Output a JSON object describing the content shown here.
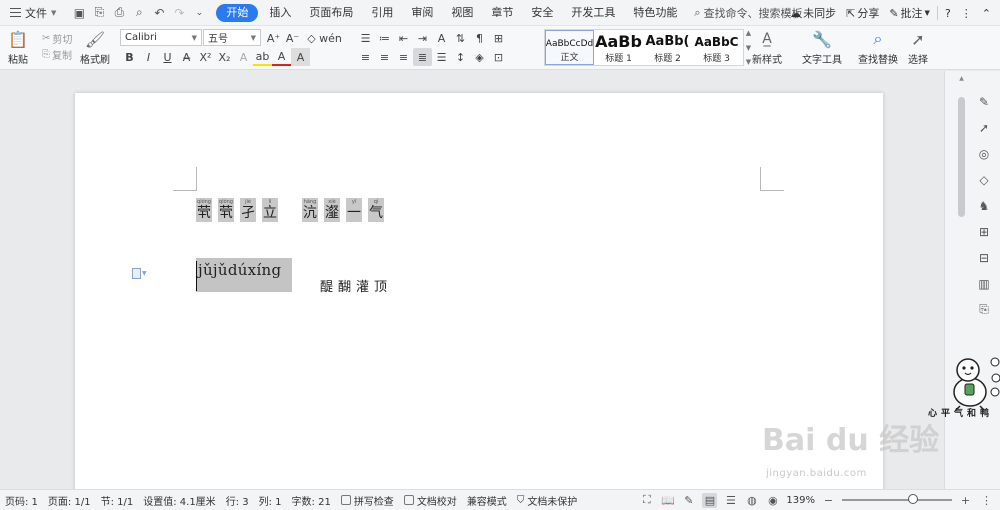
{
  "menubar": {
    "file_label": "文件",
    "tabs": [
      "开始",
      "插入",
      "页面布局",
      "引用",
      "审阅",
      "视图",
      "章节",
      "安全",
      "开发工具",
      "特色功能"
    ],
    "active_tab": "开始",
    "search_label": "查找命令、搜索模板",
    "sync_label": "未同步",
    "share_label": "分享",
    "comment_label": "批注",
    "help_label": "?"
  },
  "ribbon": {
    "paste_label": "粘贴",
    "cut_label": "剪切",
    "copy_label": "复制",
    "format_painter_label": "格式刷",
    "font_name": "Calibri",
    "font_size": "五号",
    "styles": [
      {
        "preview": "AaBbCcDd",
        "name": "正文"
      },
      {
        "preview": "AaBb",
        "name": "标题 1"
      },
      {
        "preview": "AaBb(",
        "name": "标题 2"
      },
      {
        "preview": "AaBbC",
        "name": "标题 3"
      }
    ],
    "new_style_label": "新样式",
    "text_tools_label": "文字工具",
    "find_replace_label": "查找替换",
    "select_label": "选择"
  },
  "document": {
    "line1_chars": [
      {
        "py": "qióng",
        "hz": "茕"
      },
      {
        "py": "qióng",
        "hz": "茕"
      },
      {
        "py": "jié",
        "hz": "孑"
      },
      {
        "py": "lì",
        "hz": "立"
      },
      {
        "py": "hàng",
        "hz": "沆"
      },
      {
        "py": "xiè",
        "hz": "瀣"
      },
      {
        "py": "yī",
        "hz": "一"
      },
      {
        "py": "qì",
        "hz": "气"
      }
    ],
    "selected_pinyin": "jǔjǔdúxíng",
    "line2_word": "醍醐灌顶"
  },
  "watermark": {
    "text": "Bai du 经验",
    "url": "jingyan.baidu.com"
  },
  "duck_caption": "心平气和鸭",
  "statusbar": {
    "page_code": "页码: 1",
    "pages": "页面: 1/1",
    "section": "节: 1/1",
    "position": "设置值: 4.1厘米",
    "row": "行: 3",
    "col": "列: 1",
    "word_count": "字数: 21",
    "spell_check": "拼写检查",
    "doc_proof": "文档校对",
    "compat_mode": "兼容模式",
    "protection": "文档未保护",
    "zoom": "139%"
  },
  "colors": {
    "accent": "#2b7bf0",
    "selection": "#c4c4c4"
  }
}
